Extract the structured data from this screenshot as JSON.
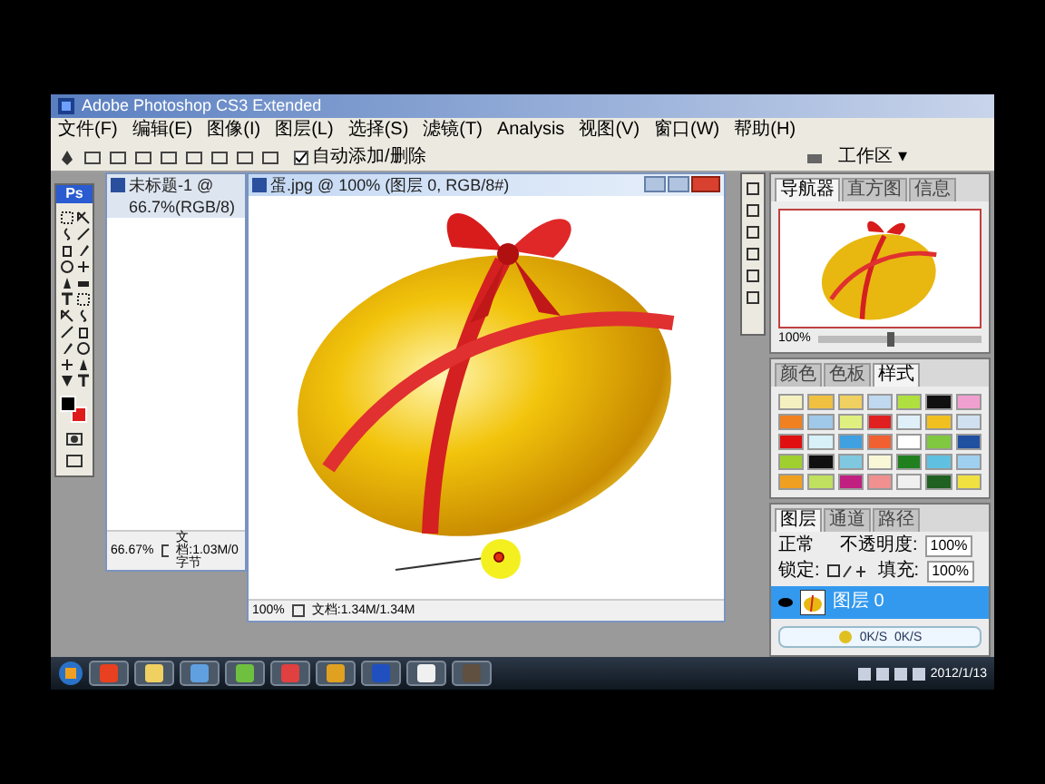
{
  "app": {
    "title": "Adobe Photoshop CS3 Extended"
  },
  "menu": [
    "文件(F)",
    "编辑(E)",
    "图像(I)",
    "图层(L)",
    "选择(S)",
    "滤镜(T)",
    "Analysis",
    "视图(V)",
    "窗口(W)",
    "帮助(H)"
  ],
  "options_bar": {
    "auto_add_delete": {
      "label": "自动添加/删除",
      "checked": true
    },
    "workspace": "工作区 ▾"
  },
  "toolbox": {
    "logo": "Ps",
    "color_chips": [
      {
        "color": "#000000"
      },
      {
        "color": "#e01b1b"
      }
    ]
  },
  "documents": [
    {
      "kind": "blank",
      "title": "未标题-1 @ 66.7%(RGB/8)",
      "zoom": "66.67%",
      "info": "文档:1.03M/0 字节",
      "active": false
    },
    {
      "kind": "image",
      "title": "蛋.jpg @ 100% (图层 0, RGB/8#)",
      "zoom": "100%",
      "info": "文档:1.34M/1.34M",
      "active": true
    }
  ],
  "navigator": {
    "tabs": [
      {
        "label": "导航器",
        "selected": true
      },
      {
        "label": "直方图",
        "selected": false
      },
      {
        "label": "信息",
        "selected": false
      }
    ],
    "zoom": "100%",
    "zoom_slider": {
      "level": 0.45
    }
  },
  "styles": {
    "tabs": [
      {
        "label": "颜色",
        "selected": false
      },
      {
        "label": "色板",
        "selected": false
      },
      {
        "label": "样式",
        "selected": true
      }
    ],
    "swatches": [
      {
        "color": "#f5f0c0"
      },
      {
        "color": "#f0c040"
      },
      {
        "color": "#f0d060"
      },
      {
        "color": "#c0d8f0"
      },
      {
        "color": "#b0e040"
      },
      {
        "color": "#101010"
      },
      {
        "color": "#f0a0d0"
      },
      {
        "color": "#f08020"
      },
      {
        "color": "#a0c8e8"
      },
      {
        "color": "#e0f080"
      },
      {
        "color": "#e02020"
      },
      {
        "color": "#e0f0f8"
      },
      {
        "color": "#f0c020"
      },
      {
        "color": "#d0e0f0"
      },
      {
        "color": "#e01010"
      },
      {
        "color": "#d8f0f8"
      },
      {
        "color": "#40a0e0"
      },
      {
        "color": "#f06030"
      },
      {
        "color": "#ffffff"
      },
      {
        "color": "#80c840"
      },
      {
        "color": "#2050a0"
      },
      {
        "color": "#a0d030"
      },
      {
        "color": "#101010"
      },
      {
        "color": "#80c8e0"
      },
      {
        "color": "#f8f8d8"
      },
      {
        "color": "#208020"
      },
      {
        "color": "#60c0e0"
      },
      {
        "color": "#a0d0f0"
      },
      {
        "color": "#f0a020"
      },
      {
        "color": "#c0e060"
      },
      {
        "color": "#c02080"
      },
      {
        "color": "#f09090"
      },
      {
        "color": "#f0f0f0"
      },
      {
        "color": "#206020"
      },
      {
        "color": "#f0e040"
      }
    ]
  },
  "layers": {
    "tabs": [
      {
        "label": "图层",
        "selected": true
      },
      {
        "label": "通道",
        "selected": false
      },
      {
        "label": "路径",
        "selected": false
      }
    ],
    "blend_mode": "正常",
    "opacity_label": "不透明度:",
    "opacity": "100%",
    "lock_label": "锁定:",
    "fill_label": "填充:",
    "fill": "100%",
    "items": [
      {
        "name": "图层 0",
        "visible": true,
        "selected": true
      }
    ]
  },
  "net_speed": [
    "0K/S",
    "0K/S"
  ],
  "taskbar": {
    "date": "2012/1/13"
  }
}
